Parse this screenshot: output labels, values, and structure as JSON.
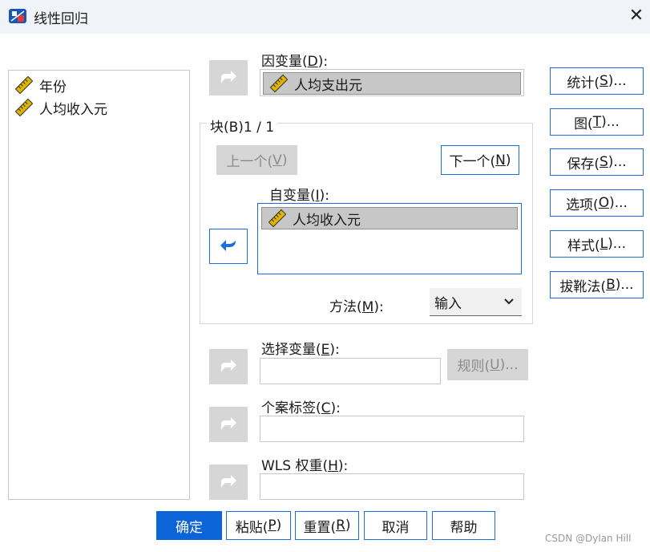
{
  "window": {
    "title": "线性回归"
  },
  "source_vars": [
    {
      "label": "年份",
      "icon": "scale-ruler-icon"
    },
    {
      "label": "人均收入元",
      "icon": "scale-ruler-icon"
    }
  ],
  "dependent": {
    "label_pre": "因变量(",
    "label_key": "D",
    "label_post": "):",
    "value": "人均支出元"
  },
  "block": {
    "title": "块(B)1 / 1",
    "prev": {
      "pre": "上一个(",
      "key": "V",
      "post": ")"
    },
    "next": {
      "pre": "下一个(",
      "key": "N",
      "post": ")"
    }
  },
  "independent": {
    "label_pre": "自变量(",
    "label_key": "I",
    "label_post": "):",
    "items": [
      "人均收入元"
    ]
  },
  "method": {
    "label_pre": "方法(",
    "label_key": "M",
    "label_post": "):",
    "value": "输入"
  },
  "selection": {
    "label_pre": "选择变量(",
    "label_key": "E",
    "label_post": "):",
    "value": "",
    "rule": {
      "pre": "规则(",
      "key": "U",
      "post": ")..."
    }
  },
  "case_labels": {
    "label_pre": "个案标签(",
    "label_key": "C",
    "label_post": "):",
    "value": ""
  },
  "wls": {
    "label_pre": "WLS 权重(",
    "label_key": "H",
    "label_post": "):",
    "value": ""
  },
  "right_buttons": [
    {
      "pre": "统计(",
      "key": "S",
      "post": ")..."
    },
    {
      "pre": "图(",
      "key": "T",
      "post": ")..."
    },
    {
      "pre": "保存(",
      "key": "S",
      "post": ")..."
    },
    {
      "pre": "选项(",
      "key": "O",
      "post": ")..."
    },
    {
      "pre": "样式(",
      "key": "L",
      "post": ")..."
    },
    {
      "pre": "拔靴法(",
      "key": "B",
      "post": ")..."
    }
  ],
  "bottom_buttons": {
    "ok": "确定",
    "paste": {
      "pre": "粘贴(",
      "key": "P",
      "post": ")"
    },
    "reset": {
      "pre": "重置(",
      "key": "R",
      "post": ")"
    },
    "cancel": "取消",
    "help": "帮助"
  },
  "watermark": "CSDN @Dylan  Hill",
  "colors": {
    "accent": "#1a6fdc",
    "primary_button": "#0b65d8",
    "disabled": "#d6d6d6"
  }
}
